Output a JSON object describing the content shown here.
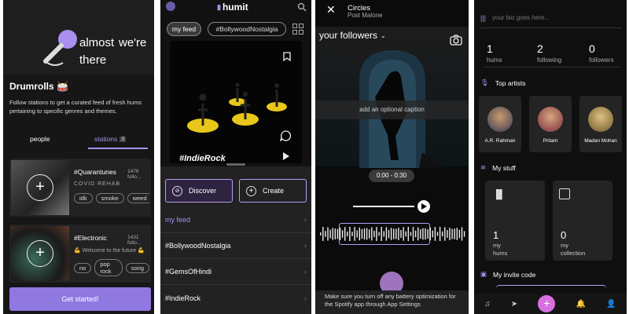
{
  "screen1": {
    "hero_text_a": "almost",
    "hero_text_b": "we're",
    "hero_text_c": "there",
    "title": "Drumrolls 🥁",
    "description": "Follow stations to get a curated feed of fresh hums pertaining to specific genres and themes.",
    "tabs": [
      "people",
      "stations"
    ],
    "stations_count": "3",
    "cards": [
      {
        "name": "#Quarantunes",
        "followers": "1476 follo...",
        "sub": "COVID REHAB",
        "tags": [
          "idk",
          "smoke",
          "weed"
        ]
      },
      {
        "name": "#Electronic",
        "followers": "1431 follo...",
        "sub": "💪 Welcome to the future 💪",
        "tags": [
          "no",
          "pop rock",
          "song"
        ]
      }
    ],
    "cta": "Get started!"
  },
  "screen2": {
    "logo": "humit",
    "tabs": [
      "my feed",
      "#BollywoodNostalgia"
    ],
    "video_tag": "#IndieRock",
    "discover": "Discover",
    "create": "Create",
    "list": [
      "my feed",
      "#BollywoodNostalgia",
      "#GemsOfHindi",
      "#IndieRock"
    ]
  },
  "screen3": {
    "song": "Circles",
    "artist": "Post Malone",
    "audience": "your followers",
    "caption_placeholder": "add an optional caption",
    "time_range": "0:00 - 0:30",
    "tip": "Make sure you turn off any battery optimization for the Spotify app through App Settings"
  },
  "screen4": {
    "bio_placeholder": "your bio goes here...",
    "stats": [
      {
        "value": "1",
        "label": "hums"
      },
      {
        "value": "2",
        "label": "following"
      },
      {
        "value": "0",
        "label": "followers"
      }
    ],
    "top_artists_title": "Top artists",
    "artists": [
      "A.R. Rahman",
      "Pritam",
      "Madan Mohan"
    ],
    "my_stuff_title": "My stuff",
    "stuff": [
      {
        "value": "1",
        "label_a": "my",
        "label_b": "hums"
      },
      {
        "value": "0",
        "label_a": "my",
        "label_b": "collection"
      }
    ],
    "invite_title": "My invite code"
  },
  "colors": {
    "accent": "#a88ff0",
    "accent_dark": "#7b63d8",
    "ring_yellow": "#e8c71a"
  }
}
